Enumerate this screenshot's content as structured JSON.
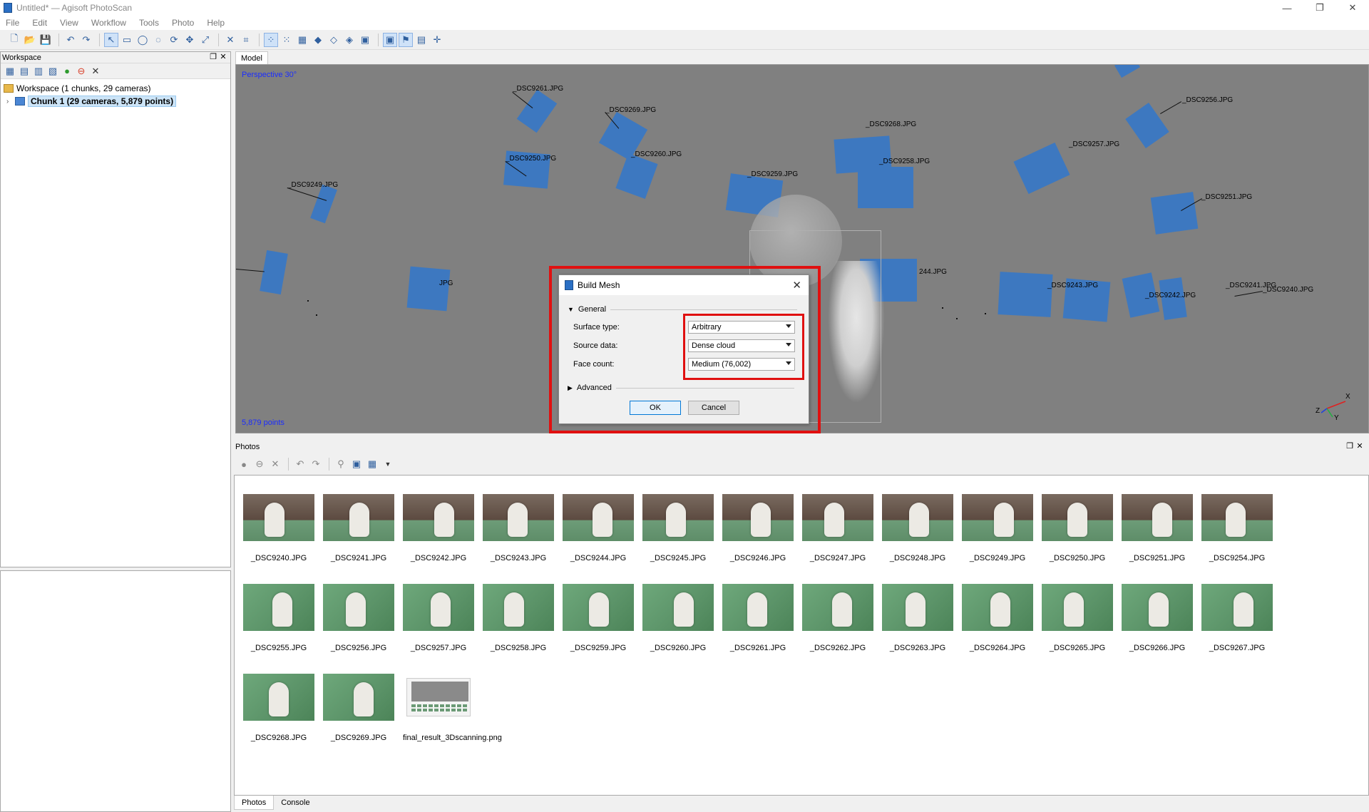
{
  "window": {
    "title": "Untitled* — Agisoft PhotoScan",
    "controls": [
      "—",
      "❐",
      "✕"
    ]
  },
  "menu": [
    "File",
    "Edit",
    "View",
    "Workflow",
    "Tools",
    "Photo",
    "Help"
  ],
  "workspace": {
    "title": "Workspace",
    "root_label": "Workspace (1 chunks, 29 cameras)",
    "chunk_label": "Chunk 1 (29 cameras, 5,879 points)"
  },
  "model": {
    "tab": "Model",
    "projection": "Perspective 30°",
    "point_count": "5,879 points",
    "axes": {
      "x": "X",
      "y": "Y",
      "z": "Z"
    },
    "camera_labels": [
      "_DSC9261.JPG",
      "_DSC9269.JPG",
      "_DSC9268.JPG",
      "_DSC9256.JPG",
      "_DSC9257.JPG",
      "_DSC9250.JPG",
      "_DSC9260.JPG",
      "_DSC9259.JPG",
      "_DSC9258.JPG",
      "_DSC9249.JPG",
      "_DSC9251.JPG",
      "244.JPG",
      "_DSC9243.JPG",
      "_DSC9242.JPG",
      "_DSC9241.JPG",
      "_DSC9240.JPG",
      "JPG"
    ]
  },
  "dialog": {
    "title": "Build Mesh",
    "general": "General",
    "advanced": "Advanced",
    "fields": [
      {
        "label": "Surface type:",
        "value": "Arbitrary"
      },
      {
        "label": "Source data:",
        "value": "Dense cloud"
      },
      {
        "label": "Face count:",
        "value": "Medium (76,002)"
      }
    ],
    "ok": "OK",
    "cancel": "Cancel"
  },
  "photos": {
    "title": "Photos",
    "items": [
      {
        "name": "_DSC9240.JPG",
        "style": "room"
      },
      {
        "name": "_DSC9241.JPG",
        "style": "room"
      },
      {
        "name": "_DSC9242.JPG",
        "style": "room"
      },
      {
        "name": "_DSC9243.JPG",
        "style": "room"
      },
      {
        "name": "_DSC9244.JPG",
        "style": "room"
      },
      {
        "name": "_DSC9245.JPG",
        "style": "room"
      },
      {
        "name": "_DSC9246.JPG",
        "style": "room"
      },
      {
        "name": "_DSC9247.JPG",
        "style": "room"
      },
      {
        "name": "_DSC9248.JPG",
        "style": "room"
      },
      {
        "name": "_DSC9249.JPG",
        "style": "room"
      },
      {
        "name": "_DSC9250.JPG",
        "style": "room"
      },
      {
        "name": "_DSC9251.JPG",
        "style": "room"
      },
      {
        "name": "_DSC9254.JPG",
        "style": "room"
      },
      {
        "name": "_DSC9255.JPG",
        "style": "green"
      },
      {
        "name": "_DSC9256.JPG",
        "style": "green"
      },
      {
        "name": "_DSC9257.JPG",
        "style": "green"
      },
      {
        "name": "_DSC9258.JPG",
        "style": "green"
      },
      {
        "name": "_DSC9259.JPG",
        "style": "green"
      },
      {
        "name": "_DSC9260.JPG",
        "style": "green"
      },
      {
        "name": "_DSC9261.JPG",
        "style": "green"
      },
      {
        "name": "_DSC9262.JPG",
        "style": "green"
      },
      {
        "name": "_DSC9263.JPG",
        "style": "green"
      },
      {
        "name": "_DSC9264.JPG",
        "style": "green"
      },
      {
        "name": "_DSC9265.JPG",
        "style": "green"
      },
      {
        "name": "_DSC9266.JPG",
        "style": "green"
      },
      {
        "name": "_DSC9267.JPG",
        "style": "green"
      },
      {
        "name": "_DSC9268.JPG",
        "style": "green"
      },
      {
        "name": "_DSC9269.JPG",
        "style": "green"
      },
      {
        "name": "final_result_3Dscanning.png",
        "style": "shot"
      }
    ]
  },
  "bottom_tabs": [
    "Photos",
    "Console"
  ],
  "colors": {
    "accent": "#3d78c0",
    "highlight": "#e01010",
    "viewport": "#808080"
  }
}
